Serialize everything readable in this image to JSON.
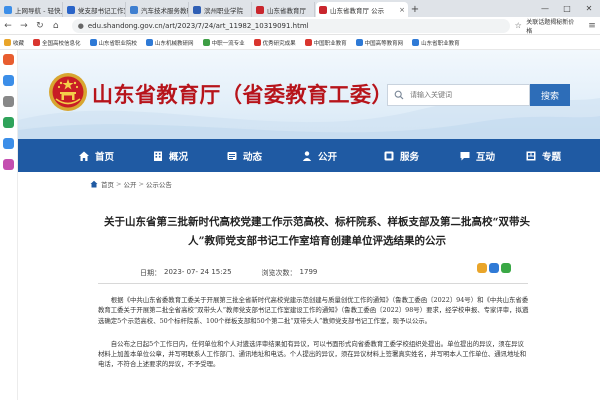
{
  "browser": {
    "tabs": [
      {
        "label": "上网导航 - 轻快上网",
        "color": "#3c8ee8",
        "active": false
      },
      {
        "label": "党支部书记工作室_百",
        "color": "#2a64c8",
        "active": false
      },
      {
        "label": "汽车技术服务教研室",
        "color": "#3f7fd0",
        "active": false
      },
      {
        "label": "滨州职业学院",
        "color": "#2f5fb5",
        "active": false
      },
      {
        "label": "山东省教育厅",
        "color": "#c9262d",
        "active": false
      },
      {
        "label": "山东省教育厅 公示",
        "color": "#c9262d",
        "active": true
      }
    ],
    "tab_close": "×",
    "new_tab": "+",
    "url": "edu.shandong.gov.cn/art/2023/7/24/art_11982_10319091.html",
    "search_hint": "关联话题揭秘新价格",
    "bookmarks": [
      {
        "label": "收藏",
        "color": "#e9a52a"
      },
      {
        "label": "全国高校信息化",
        "color": "#d9362f"
      },
      {
        "label": "山东省职业院校",
        "color": "#2f7ad6"
      },
      {
        "label": "山东机械教研网",
        "color": "#2f7ad6"
      },
      {
        "label": "中职一流专业",
        "color": "#3e9e45"
      },
      {
        "label": "优秀研究成果",
        "color": "#d9362f"
      },
      {
        "label": "中国职业教育",
        "color": "#d9362f"
      },
      {
        "label": "中国高等教育网",
        "color": "#2f7ad6"
      },
      {
        "label": "山东省职业教育",
        "color": "#2f7ad6"
      }
    ]
  },
  "sidebar_icons": [
    {
      "name": "home-sidebar-icon",
      "color": "#e85d2f"
    },
    {
      "name": "star-sidebar-icon",
      "color": "#3c8ee8"
    },
    {
      "name": "history-sidebar-icon",
      "color": "#888888"
    },
    {
      "name": "download-sidebar-icon",
      "color": "#2fa35a"
    },
    {
      "name": "mail-sidebar-icon",
      "color": "#3c8ee8"
    },
    {
      "name": "apps-sidebar-icon",
      "color": "#c44eb0"
    }
  ],
  "site": {
    "title": "山东省教育厅（省委教育工委）",
    "search_placeholder": "请输入关键词",
    "search_button": "搜索",
    "title_color": "#b7141b",
    "nav_color": "#1f5aa3",
    "nav": [
      {
        "label": "首页",
        "icon": "home-icon"
      },
      {
        "label": "概况",
        "icon": "building-icon"
      },
      {
        "label": "动态",
        "icon": "news-icon"
      },
      {
        "label": "公开",
        "icon": "people-icon"
      },
      {
        "label": "服务",
        "icon": "service-icon"
      },
      {
        "label": "互动",
        "icon": "chat-icon"
      },
      {
        "label": "专题",
        "icon": "topic-icon"
      }
    ]
  },
  "breadcrumb": {
    "items": [
      "首页",
      "公开",
      "公示公告"
    ],
    "separator": ">"
  },
  "article": {
    "title": "关于山东省第三批新时代高校党建工作示范高校、标杆院系、样板支部及第二批高校“双带头人”教师党支部书记工作室培育创建单位评选结果的公示",
    "date_label": "日期：",
    "date": "2023- 07- 24 15:25",
    "views_label": "浏览次数：",
    "views": "1799",
    "paragraph1": "根据《中共山东省委教育工委关于开展第三批全省新时代高校党建示范创建与质量创优工作的通知》（鲁教工委函〔2022〕94号）和《中共山东省委教育工委关于开展第二批全省高校“双带头人”教师党支部书记工作室建设工作的通知》（鲁教工委函〔2022〕98号）要求，经学校申报、专家评审，拟遴选确定5个示范高校、50个标杆院系、100个样板支部和50个第二批“双带头人”教师党支部书记工作室，现予以公示。",
    "paragraph2": "自公布之日起5个工作日内，任何单位和个人对遴选评审结果如有异议，可以书面形式向省委教育工委学校组织处提出。单位提出的异议，须在异议材料上加盖本单位公章，并写明联系人工作部门、通讯地址和电话。个人提出的异议，须在异议材料上签署真实姓名，并写明本人工作单位、通讯地址和电话，不符合上述要求的异议，不予受理。"
  }
}
